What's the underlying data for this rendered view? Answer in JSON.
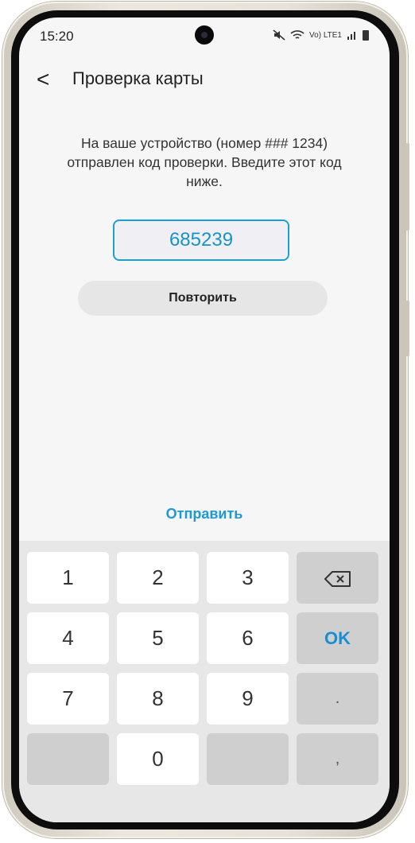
{
  "status": {
    "time": "15:20",
    "network": "Vo) LTE1"
  },
  "header": {
    "back_symbol": "<",
    "title": "Проверка карты"
  },
  "message": "На ваше устройство (номер ### 1234) отправлен код проверки. Введите этот код ниже.",
  "code_input": {
    "value": "685239"
  },
  "retry_label": "Повторить",
  "send_label": "Отправить",
  "keyboard": {
    "k1": "1",
    "k2": "2",
    "k3": "3",
    "k4": "4",
    "k5": "5",
    "k6": "6",
    "k7": "7",
    "k8": "8",
    "k9": "9",
    "k0": "0",
    "ok": "OK",
    "dot": ".",
    "comma": ","
  },
  "colors": {
    "accent": "#1a9ad6",
    "screen_bg": "#f6f6f6",
    "keyboard_bg": "#e7e7e7"
  }
}
